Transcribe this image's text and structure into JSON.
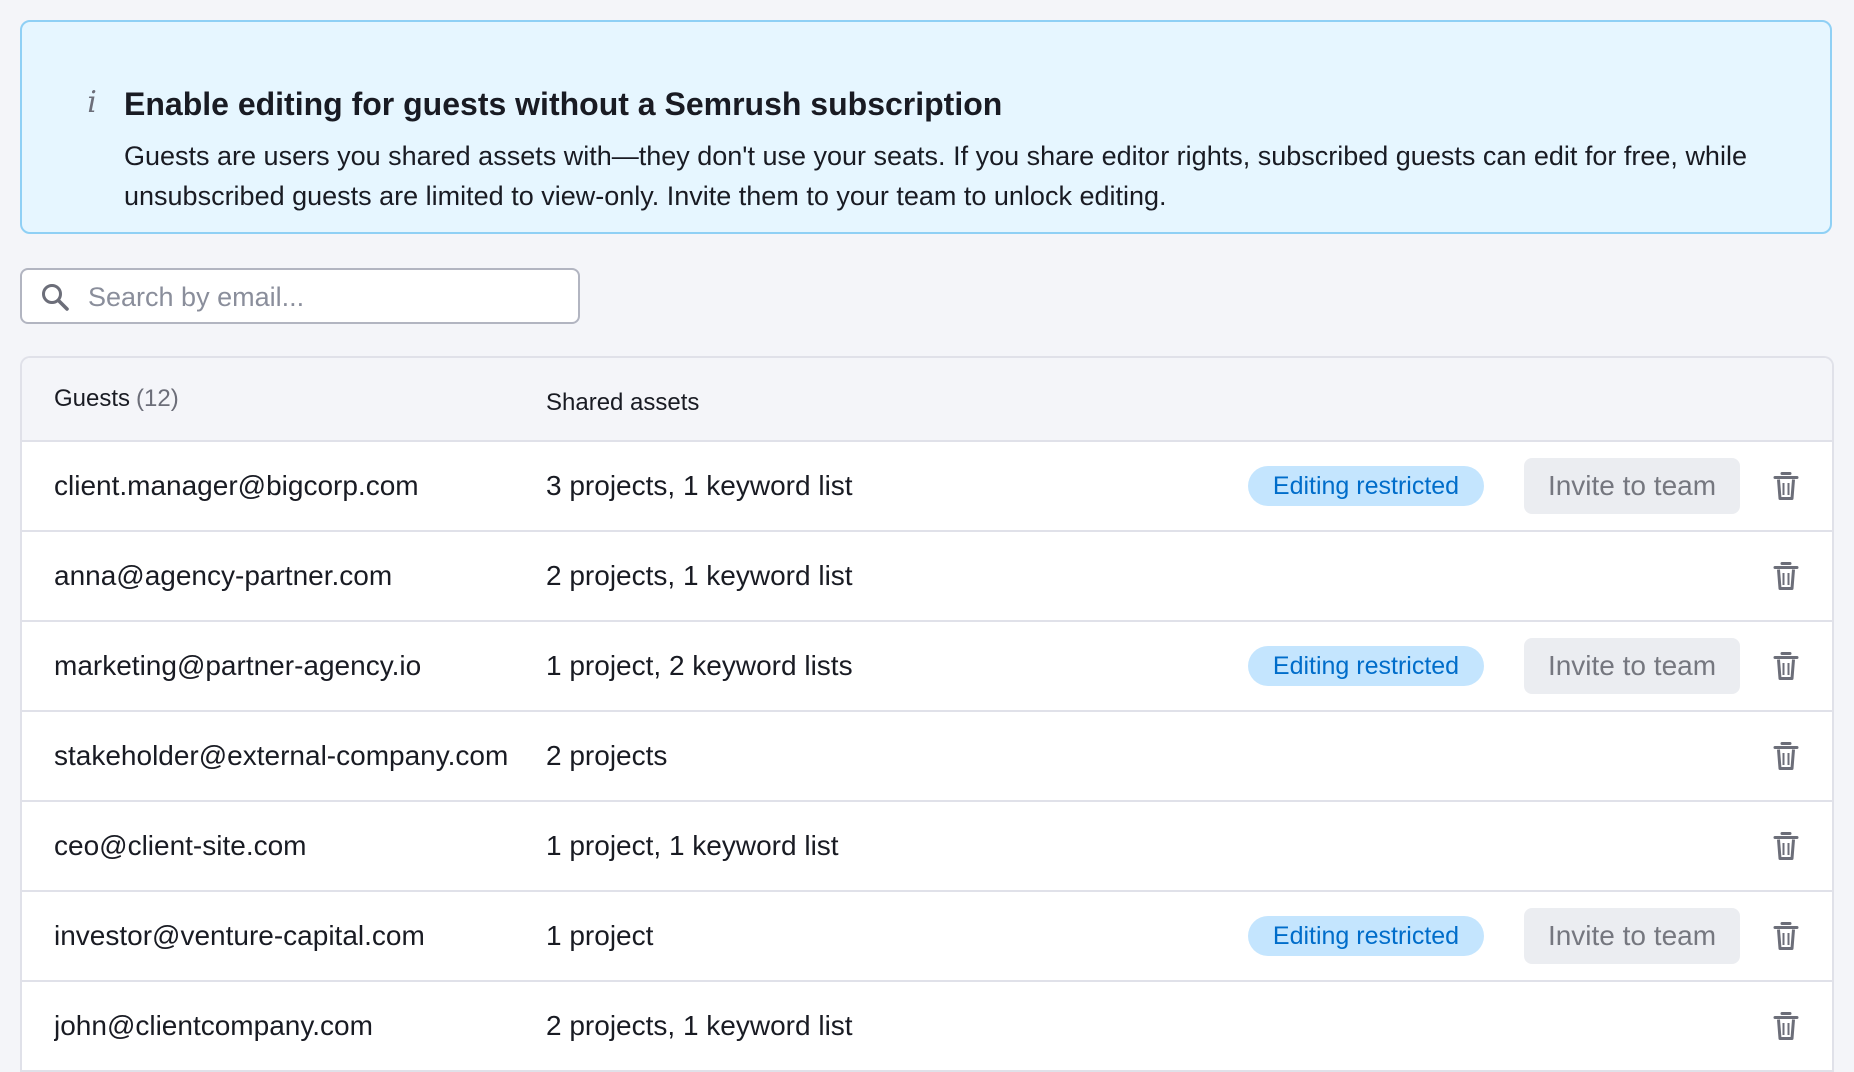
{
  "banner": {
    "icon": "info-icon",
    "icon_glyph": "i",
    "title": "Enable editing for guests without a Semrush subscription",
    "text": "Guests are users you shared assets with—they don't use your seats. If you share editor rights, subscribed guests can edit for free, while unsubscribed guests are limited to view-only. Invite them to your team to unlock editing."
  },
  "search": {
    "icon": "search-icon",
    "placeholder": "Search by email...",
    "value": ""
  },
  "table": {
    "headers": {
      "guests": "Guests",
      "guests_count": "(12)",
      "shared_assets": "Shared assets"
    },
    "badge_label": "Editing restricted",
    "invite_label": "Invite to team",
    "delete_icon": "trash-icon",
    "rows": [
      {
        "email": "client.manager@bigcorp.com",
        "assets": "3 projects, 1 keyword list",
        "restricted": true
      },
      {
        "email": "anna@agency-partner.com",
        "assets": "2 projects, 1 keyword list",
        "restricted": false
      },
      {
        "email": "marketing@partner-agency.io",
        "assets": "1 project, 2 keyword lists",
        "restricted": true
      },
      {
        "email": "stakeholder@external-company.com",
        "assets": "2 projects",
        "restricted": false
      },
      {
        "email": "ceo@client-site.com",
        "assets": "1 project, 1 keyword list",
        "restricted": false
      },
      {
        "email": "investor@venture-capital.com",
        "assets": "1 project",
        "restricted": true
      },
      {
        "email": "john@clientcompany.com",
        "assets": "2 projects, 1 keyword list",
        "restricted": false
      }
    ]
  },
  "colors": {
    "banner_bg": "#e6f6ff",
    "banner_border": "#8fd0f5",
    "badge_bg": "#c4e5fe",
    "badge_text": "#006dca",
    "button_bg": "#ebedf1",
    "button_text": "#75777f"
  }
}
